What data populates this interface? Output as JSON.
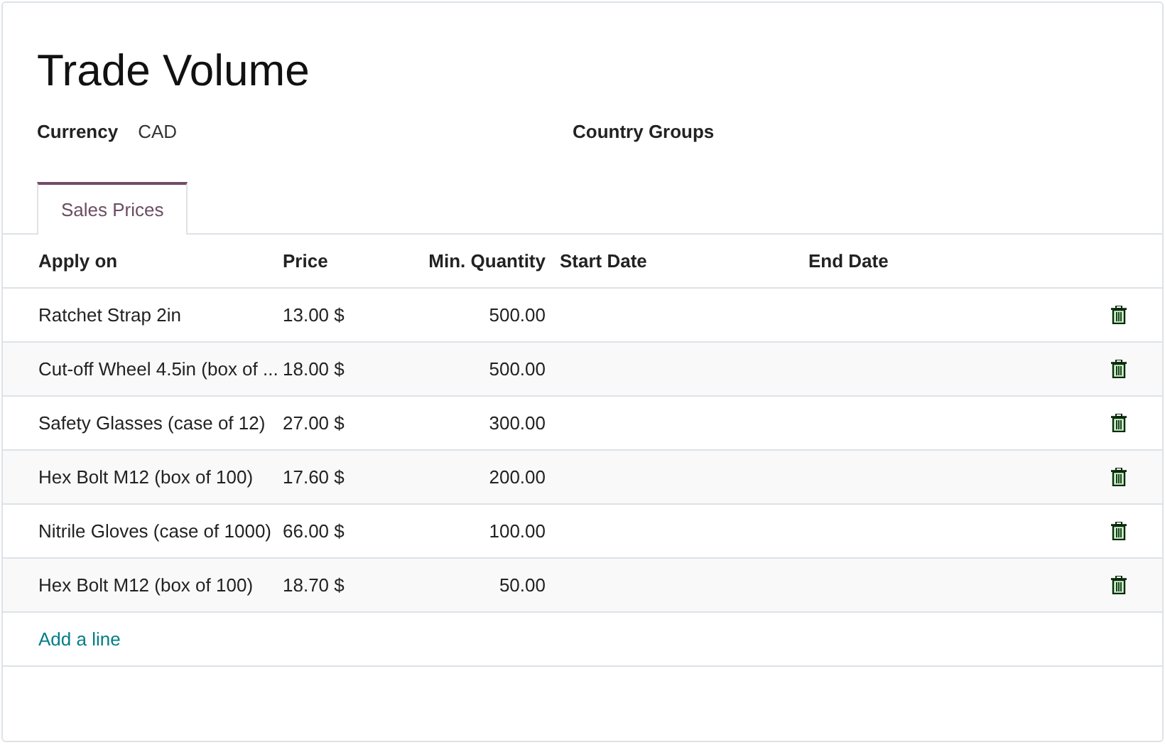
{
  "title": "Trade Volume",
  "fields": [
    {
      "label": "Currency",
      "value": "CAD"
    },
    {
      "label": "Country Groups"
    }
  ],
  "tabs": [
    {
      "label": "Sales Prices",
      "selected": true
    }
  ],
  "table": {
    "columns": [
      "Apply on",
      "Price",
      "Min. Quantity",
      "Start Date",
      "End Date"
    ],
    "rows": [
      {
        "apply_on": "Ratchet Strap 2in",
        "price": "13.00 $",
        "min_quantity": "500.00"
      },
      {
        "apply_on": "Cut-off Wheel 4.5in (box of ...",
        "price": "18.00 $",
        "min_quantity": "500.00"
      },
      {
        "apply_on": "Safety Glasses (case of 12)",
        "price": "27.00 $",
        "min_quantity": "300.00"
      },
      {
        "apply_on": "Hex Bolt M12 (box of 100)",
        "price": "17.60 $",
        "min_quantity": "200.00"
      },
      {
        "apply_on": "Nitrile Gloves (case of 1000)",
        "price": "66.00 $",
        "min_quantity": "100.00"
      },
      {
        "apply_on": "Hex Bolt M12 (box of 100)",
        "price": "18.70 $",
        "min_quantity": "50.00"
      }
    ],
    "add_line": "Add a line"
  }
}
